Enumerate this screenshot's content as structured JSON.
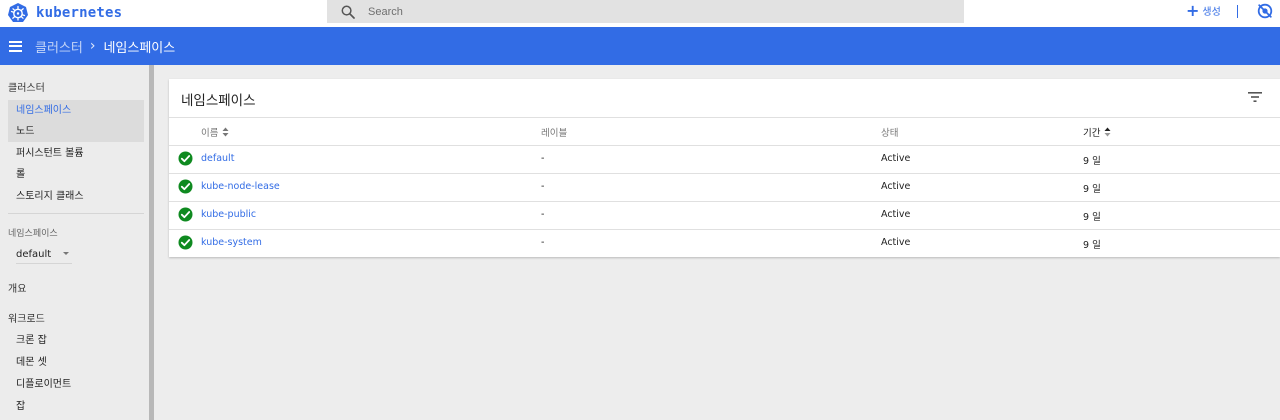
{
  "topbar": {
    "brand": "kubernetes",
    "search_placeholder": "Search",
    "create_label": "생성",
    "icons": {
      "logo": "kubernetes-wheel-icon",
      "search": "search-icon",
      "create": "plus-icon",
      "visibility": "visibility-off-icon"
    },
    "accent_color": "#326ce5"
  },
  "breadcrumb": {
    "parent": "클러스터",
    "separator": "›",
    "current": "네임스페이스"
  },
  "sidebar": {
    "cluster_heading": "클러스터",
    "cluster_items": [
      {
        "label": "네임스페이스",
        "active": true
      },
      {
        "label": "노드",
        "active": false
      },
      {
        "label": "퍼시스턴트 볼륨",
        "active": false
      },
      {
        "label": "롤",
        "active": false
      },
      {
        "label": "스토리지 클래스",
        "active": false
      }
    ],
    "namespace_label": "네임스페이스",
    "namespace_value": "default",
    "overview": "개요",
    "workloads_heading": "워크로드",
    "workload_items": [
      "크론 잡",
      "데몬 셋",
      "디플로이먼트",
      "잡"
    ]
  },
  "card": {
    "title": "네임스페이스",
    "columns": {
      "name": "이름",
      "labels": "레이블",
      "status": "상태",
      "age": "기간"
    },
    "rows": [
      {
        "name": "default",
        "labels": "-",
        "status": "Active",
        "age": "9 일"
      },
      {
        "name": "kube-node-lease",
        "labels": "-",
        "status": "Active",
        "age": "9 일"
      },
      {
        "name": "kube-public",
        "labels": "-",
        "status": "Active",
        "age": "9 일"
      },
      {
        "name": "kube-system",
        "labels": "-",
        "status": "Active",
        "age": "9 일"
      }
    ],
    "status_color": "#0f8a20"
  }
}
